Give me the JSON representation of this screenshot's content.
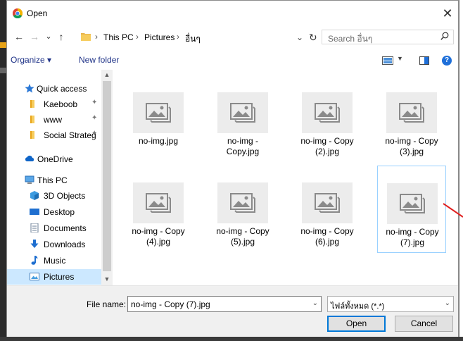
{
  "window": {
    "title": "Open",
    "close_glyph": "✕"
  },
  "nav": {
    "back_glyph": "←",
    "forward_glyph": "→",
    "recent_glyph": "⌄",
    "up_glyph": "↑",
    "breadcrumbs": [
      "This PC",
      "Pictures",
      "อื่นๆ"
    ],
    "sep_glyph": "›",
    "addr_dropdown_glyph": "⌄",
    "refresh_glyph": "↻"
  },
  "search": {
    "placeholder": "Search อื่นๆ"
  },
  "toolbar": {
    "organize_label": "Organize ▾",
    "new_folder_label": "New folder",
    "help_glyph": "?"
  },
  "sidebar": {
    "items": [
      {
        "label": "Quick access",
        "icon": "star-icon",
        "pinned": false
      },
      {
        "label": "Kaeboob",
        "icon": "folder-icon",
        "pinned": true
      },
      {
        "label": "www",
        "icon": "folder-icon",
        "pinned": true
      },
      {
        "label": "Social Strateg",
        "icon": "folder-icon",
        "pinned": true
      },
      {
        "label": "OneDrive",
        "icon": "cloud-icon",
        "pinned": false
      },
      {
        "label": "This PC",
        "icon": "computer-icon",
        "pinned": false
      },
      {
        "label": "3D Objects",
        "icon": "cube-icon",
        "pinned": false
      },
      {
        "label": "Desktop",
        "icon": "desktop-icon",
        "pinned": false
      },
      {
        "label": "Documents",
        "icon": "document-icon",
        "pinned": false
      },
      {
        "label": "Downloads",
        "icon": "download-icon",
        "pinned": false
      },
      {
        "label": "Music",
        "icon": "music-icon",
        "pinned": false
      },
      {
        "label": "Pictures",
        "icon": "pictures-icon",
        "pinned": false,
        "selected": true
      }
    ],
    "pin_glyph": "📌",
    "scroll_up_glyph": "▲",
    "scroll_down_glyph": "▼"
  },
  "files": [
    {
      "name_line1": "no-img.jpg",
      "name_line2": ""
    },
    {
      "name_line1": "no-img -",
      "name_line2": "Copy.jpg"
    },
    {
      "name_line1": "no-img - Copy",
      "name_line2": "(2).jpg"
    },
    {
      "name_line1": "no-img - Copy",
      "name_line2": "(3).jpg"
    },
    {
      "name_line1": "no-img - Copy",
      "name_line2": "(4).jpg"
    },
    {
      "name_line1": "no-img - Copy",
      "name_line2": "(5).jpg"
    },
    {
      "name_line1": "no-img - Copy",
      "name_line2": "(6).jpg"
    },
    {
      "name_line1": "no-img - Copy",
      "name_line2": "(7).jpg",
      "selected": true
    }
  ],
  "footer": {
    "file_name_label": "File name:",
    "file_name_value": "no-img - Copy (7).jpg",
    "file_type_value": "ไฟล์ทั้งหมด (*.*)",
    "dropdown_glyph": "⌄",
    "open_label": "Open",
    "cancel_label": "Cancel"
  },
  "colors": {
    "accent": "#0078d7",
    "selection": "#cce8ff",
    "link": "#1e3287",
    "annotation": "#e02020"
  }
}
